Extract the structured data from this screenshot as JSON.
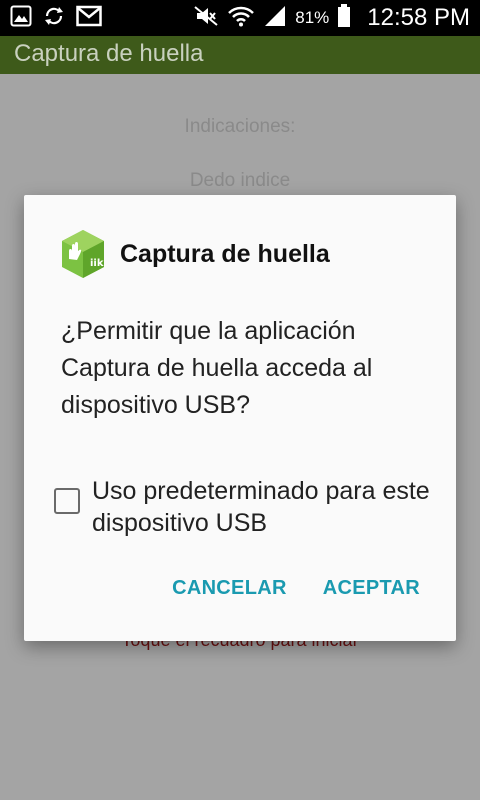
{
  "status_bar": {
    "battery_percent": "81%",
    "time": "12:58 PM",
    "icons_left": [
      "gallery-icon",
      "sync-icon",
      "gmail-icon"
    ],
    "icons_right": [
      "mute-icon",
      "wifi-icon",
      "signal-icon",
      "battery-icon"
    ]
  },
  "app_bar": {
    "title": "Captura de huella",
    "color": "#3e5a1a"
  },
  "background": {
    "indicaciones": "Indicaciones:",
    "dedo": "Dedo indice",
    "toque": "Toque el recuadro para iniciar"
  },
  "dialog": {
    "icon": "app-logo-icon",
    "title": "Captura de huella",
    "message": "¿Permitir que la aplicación Captura de huella acceda al dispositivo USB?",
    "checkbox_label": "Uso predeterminado para este dispositivo USB",
    "checkbox_checked": false,
    "cancel_label": "CANCELAR",
    "accept_label": "ACEPTAR",
    "button_color": "#1a9ab0"
  }
}
